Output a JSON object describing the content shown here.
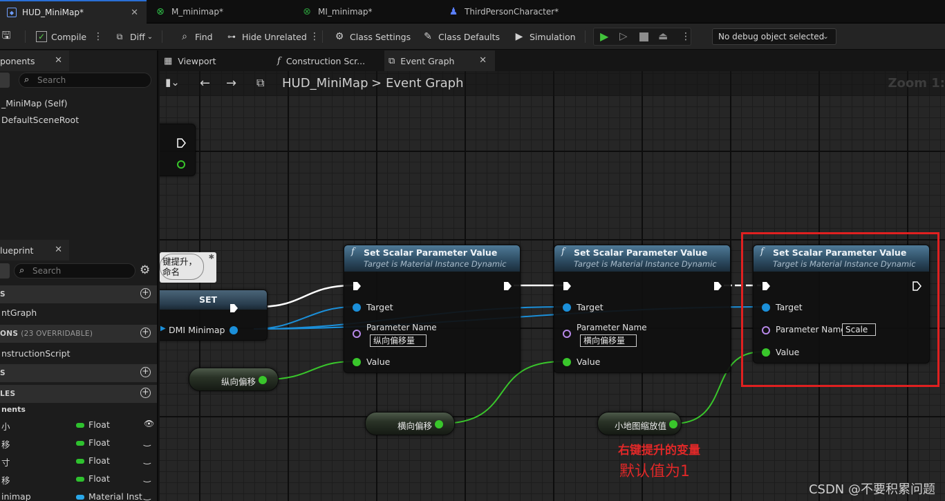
{
  "doc_tabs": [
    {
      "label": "HUD_MiniMap*",
      "icon": "widget-blueprint-icon",
      "active": true
    },
    {
      "label": "M_minimap*",
      "icon": "material-icon"
    },
    {
      "label": "MI_minimap*",
      "icon": "material-instance-icon"
    },
    {
      "label": "ThirdPersonCharacter*",
      "icon": "character-icon"
    }
  ],
  "toolbar": {
    "compile": "Compile",
    "diff": "Diff",
    "find": "Find",
    "hide_unrelated": "Hide Unrelated",
    "class_settings": "Class Settings",
    "class_defaults": "Class Defaults",
    "simulation": "Simulation",
    "debug_object": "No debug object selected"
  },
  "components_panel": {
    "tab": "ponents",
    "search_placeholder": "Search",
    "items": [
      "_MiniMap (Self)",
      "DefaultSceneRoot"
    ]
  },
  "blueprint_panel": {
    "tab": "lueprint",
    "search_placeholder": "Search",
    "sections": {
      "graphs": "S",
      "event_graph": "ntGraph",
      "functions": "ONS",
      "functions_sub": "(23 OVERRIDABLE)",
      "construction_script": "nstructionScript",
      "macros": "S",
      "variables": "LES",
      "components": "nents"
    },
    "variables": [
      {
        "name": "小",
        "type": "Float",
        "color": "#2ec12e"
      },
      {
        "name": "移",
        "type": "Float",
        "color": "#2ec12e"
      },
      {
        "name": "寸",
        "type": "Float",
        "color": "#2ec12e"
      },
      {
        "name": "移",
        "type": "Float",
        "color": "#2ec12e"
      },
      {
        "name": "inimap",
        "type": "Material Inst",
        "color": "#2aa7e8"
      }
    ]
  },
  "editor_tabs": [
    {
      "label": "Viewport",
      "icon": "viewport-icon"
    },
    {
      "label": "Construction Scr...",
      "icon": "function-icon"
    },
    {
      "label": "Event Graph",
      "icon": "graph-icon",
      "active": true
    }
  ],
  "graph": {
    "crumb_root": "HUD_MiniMap",
    "crumb_sep": ">",
    "crumb_leaf": "Event Graph",
    "zoom": "Zoom 1:"
  },
  "comment_text": "键提升，\n命名",
  "set_node": {
    "title": "SET",
    "pin": "DMI Minimap"
  },
  "scalar_nodes": [
    {
      "title": "Set Scalar Parameter Value",
      "subtitle": "Target is Material Instance Dynamic",
      "target": "Target",
      "param_label": "Parameter Name",
      "param_value": "纵向偏移量",
      "value": "Value"
    },
    {
      "title": "Set Scalar Parameter Value",
      "subtitle": "Target is Material Instance Dynamic",
      "target": "Target",
      "param_label": "Parameter Name",
      "param_value": "横向偏移量",
      "value": "Value"
    },
    {
      "title": "Set Scalar Parameter Value",
      "subtitle": "Target is Material Instance Dynamic",
      "target": "Target",
      "param_label": "Parameter Name",
      "param_value": "Scale",
      "value": "Value"
    }
  ],
  "var_nodes": [
    "纵向偏移",
    "横向偏移",
    "小地图缩放值"
  ],
  "annotation": {
    "line1": "右键提升的变量",
    "line2": "默认值为1"
  },
  "watermark": "CSDN @不要积累问题",
  "colors": {
    "exec": "#ffffff",
    "object_pin": "#1b8fd9",
    "float_pin": "#39c62b",
    "name_pin": "#b788e8",
    "highlight": "#e02020"
  }
}
